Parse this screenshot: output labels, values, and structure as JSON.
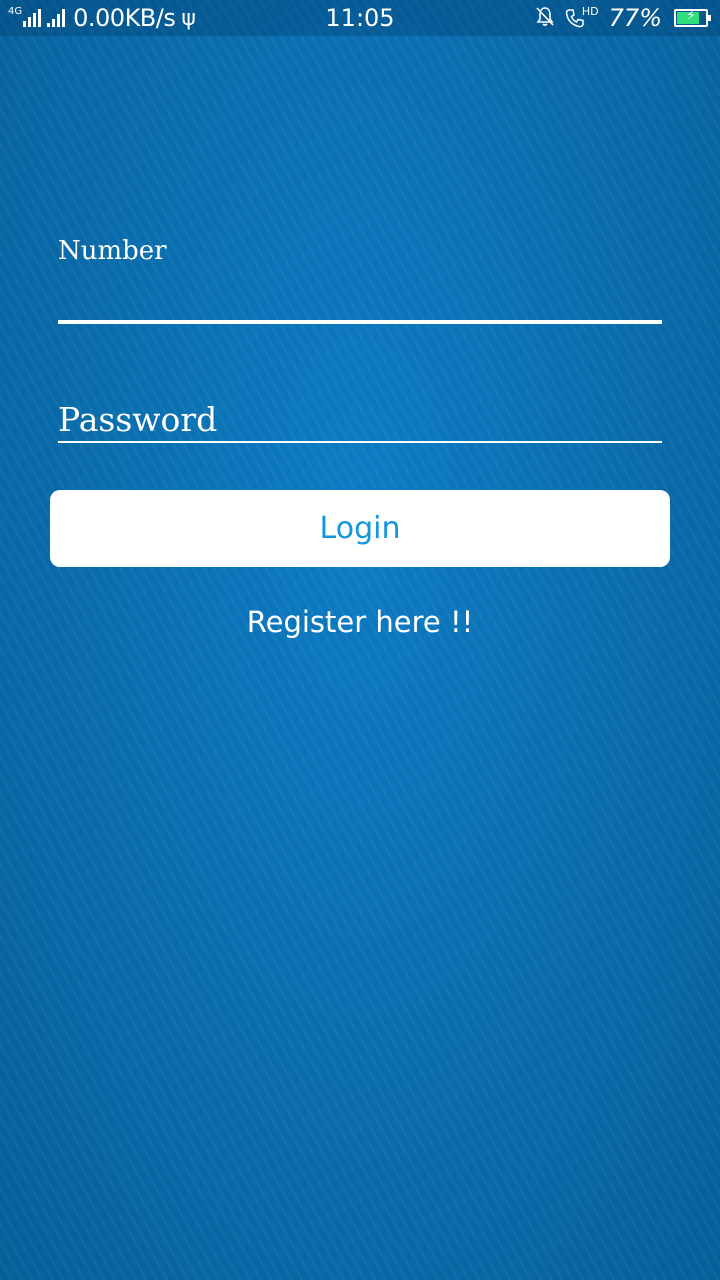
{
  "status_bar": {
    "network_type": "4G",
    "data_speed": "0.00KB/s",
    "time": "11:05",
    "hd_label": "HD",
    "battery_percent": "77%",
    "battery_level": 0.77,
    "icons": [
      "signal-icon",
      "usb-icon",
      "bell-muted-icon",
      "hd-call-icon",
      "battery-charging-icon"
    ]
  },
  "form": {
    "number_label": "Number",
    "password_label": "Password",
    "login_label": "Login",
    "register_label": "Register here !!"
  },
  "colors": {
    "background": "#0a6aa9",
    "button_background": "#ffffff",
    "button_text": "#1596df",
    "battery_fill": "#2ee07a"
  }
}
